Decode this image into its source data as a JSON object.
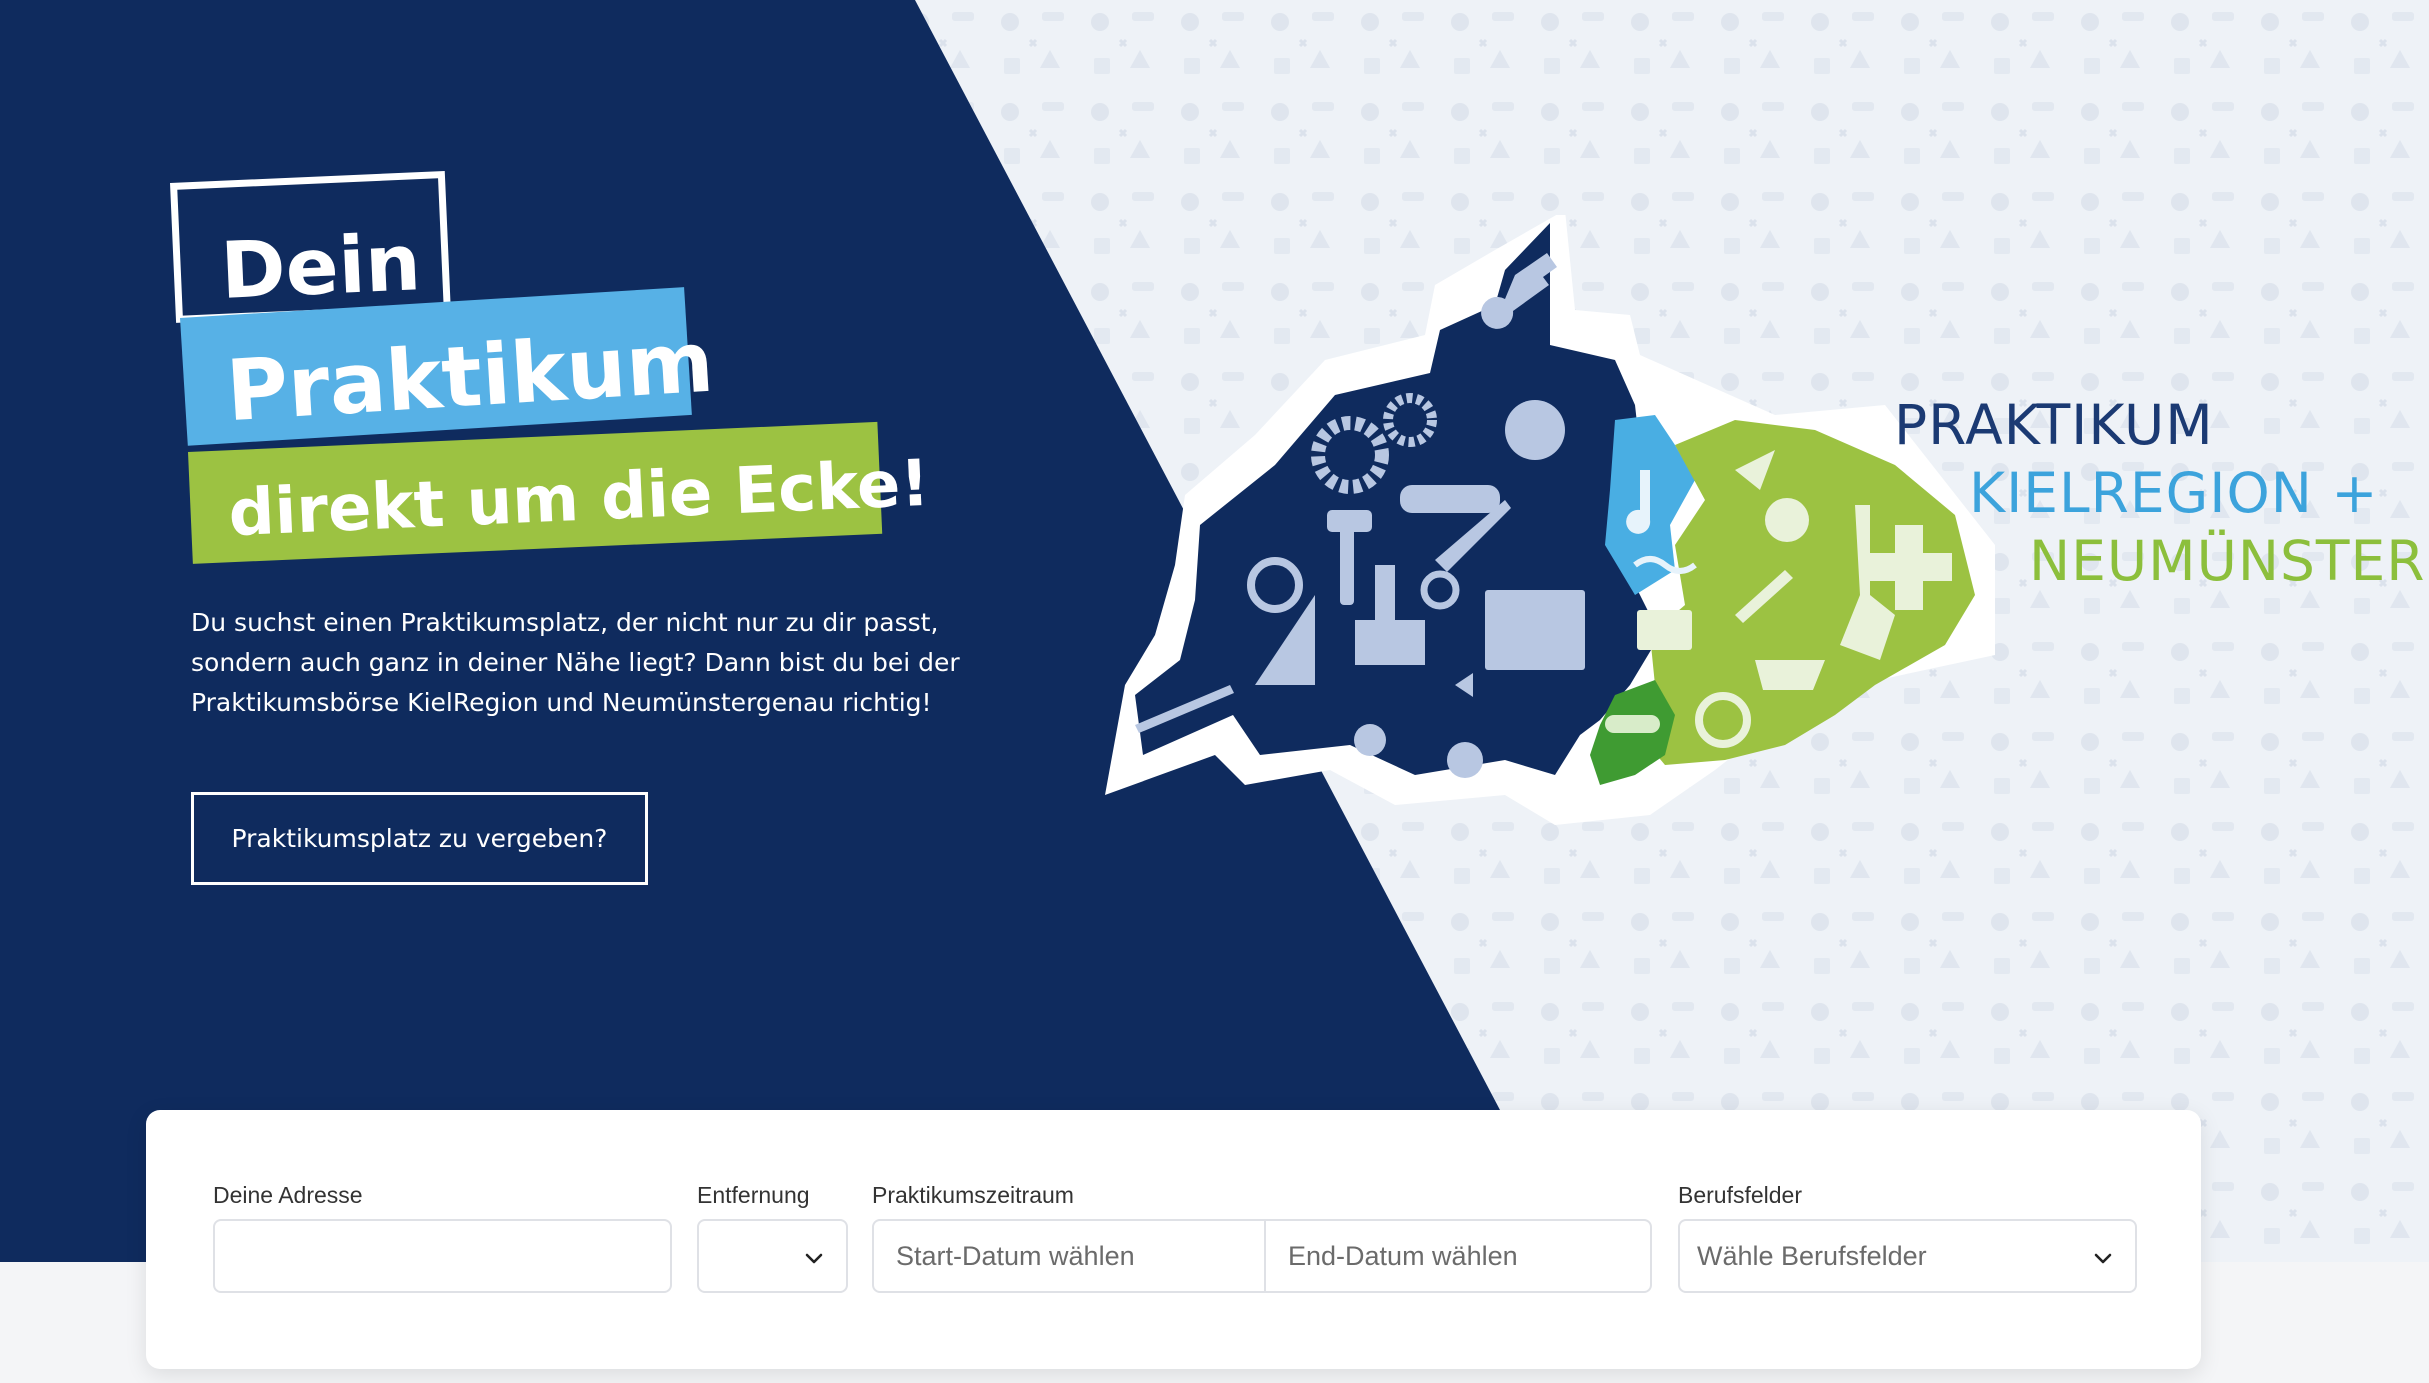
{
  "hero": {
    "tag_line1": "Dein",
    "tag_line2": "Praktikum",
    "tag_line3": "direkt um die Ecke!",
    "intro_text": "Du suchst einen Praktikumsplatz, der nicht nur zu dir passt, sondern auch ganz in deiner Nähe liegt? Dann bist du bei der Praktikumsbörse KielRegion und Neumünstergenau richtig!",
    "cta_label": "Praktikumsplatz zu vergeben?"
  },
  "logo": {
    "line1": "PRAKTIKUM",
    "line2": "KIELREGION +",
    "line3": "NEUMÜNSTER"
  },
  "search": {
    "address_label": "Deine Adresse",
    "address_placeholder": "",
    "distance_label": "Entfernung",
    "distance_value": "",
    "period_label": "Praktikumszeitraum",
    "start_placeholder": "Start-Datum wählen",
    "end_placeholder": "End-Datum wählen",
    "fields_label": "Berufsfelder",
    "fields_placeholder": "Wähle Berufsfelder"
  },
  "colors": {
    "navy": "#0f2b5e",
    "light_blue": "#57b1e6",
    "green": "#9cc242",
    "dark_green": "#3f9b32",
    "pattern_bg": "#eef1f6"
  },
  "icons": [
    "wrench-icon",
    "gear-icon",
    "wheelchair-icon",
    "hammer-icon",
    "brush-icon",
    "scissors-icon",
    "car-icon",
    "bricks-icon",
    "paw-icon",
    "lightbulb-icon",
    "music-note-icon",
    "trowel-icon",
    "chef-hat-icon",
    "shovel-icon",
    "plus-cross-icon",
    "envelope-icon",
    "shopping-cart-icon",
    "recycle-icon",
    "chevron-down-icon"
  ]
}
